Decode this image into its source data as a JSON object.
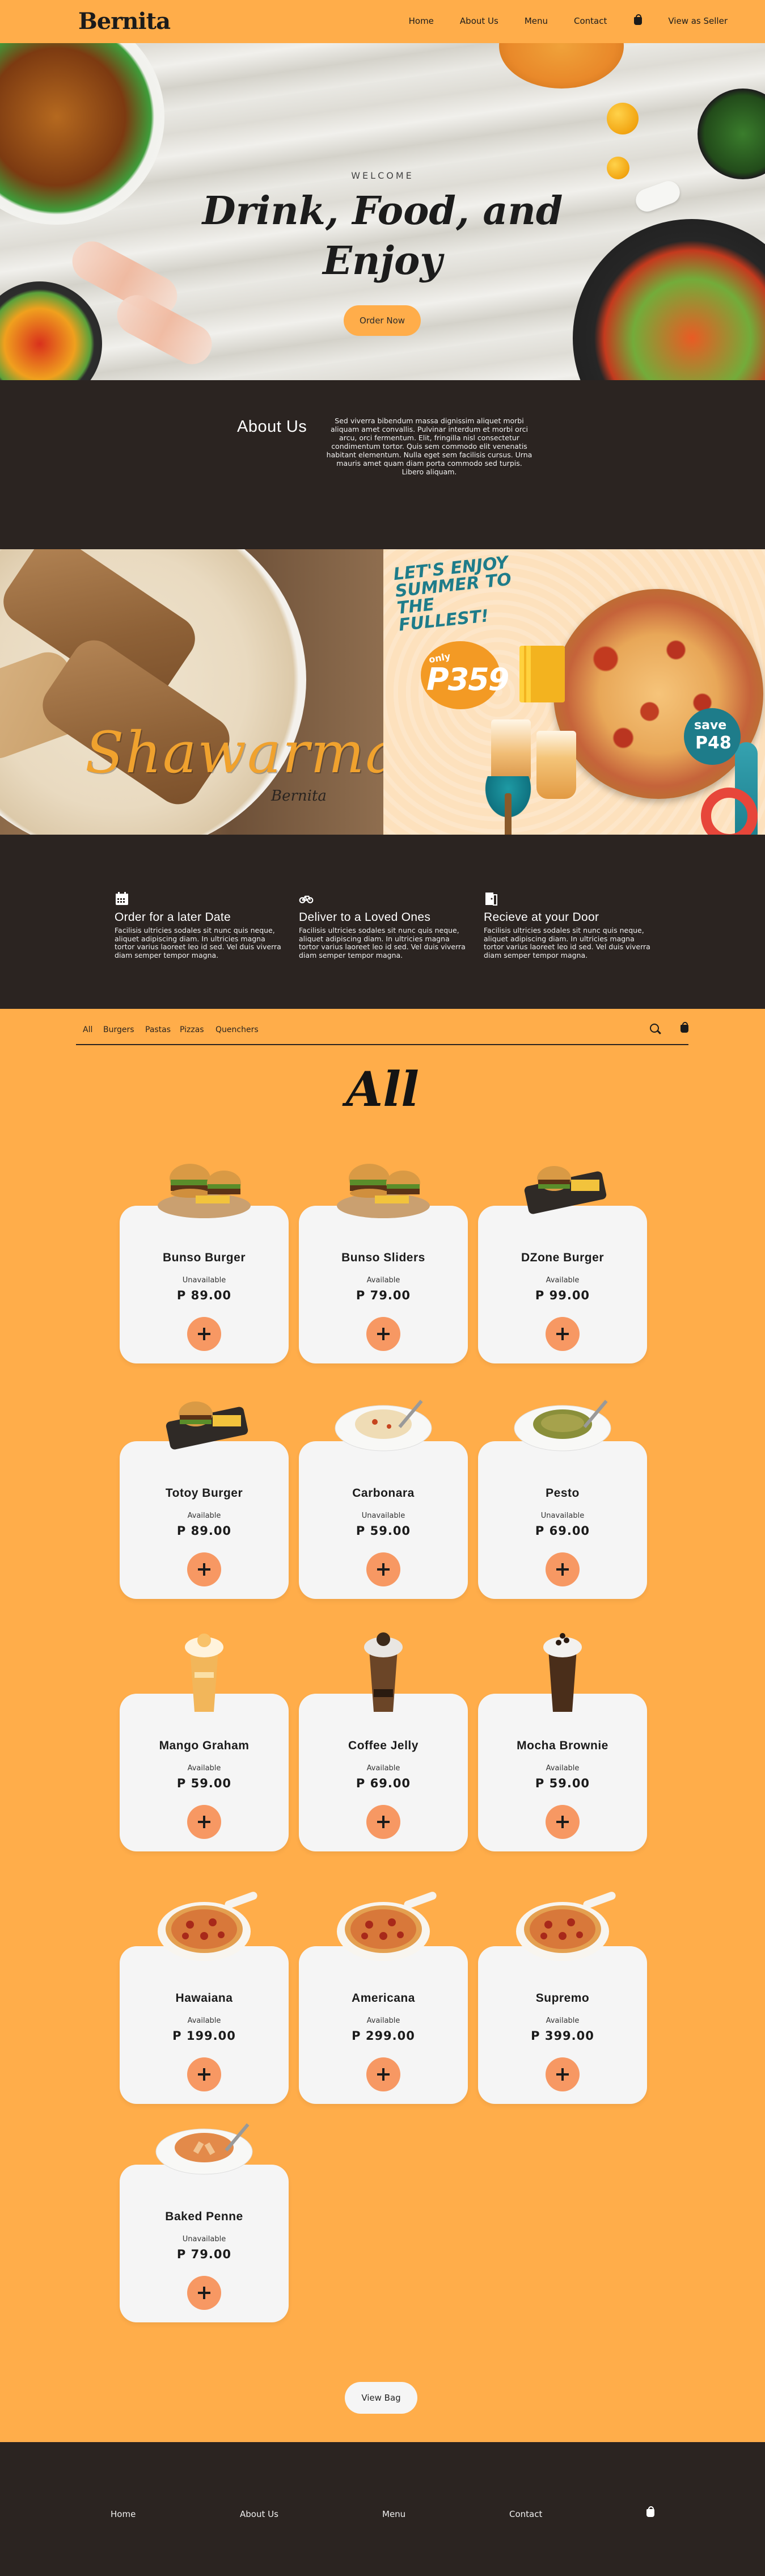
{
  "nav": {
    "brand": "Bernita",
    "brand_tag": "·",
    "links": [
      "Home",
      "About Us",
      "Menu",
      "Contact"
    ],
    "seller": "View as Seller"
  },
  "hero": {
    "welcome": "WELCOME",
    "title_line1": "Drink, Food, and",
    "title_line2": "Enjoy",
    "cta": "Order Now"
  },
  "about": {
    "title": "About Us",
    "text": "Sed viverra bibendum massa dignissim aliquet morbi aliquam amet convallis. Pulvinar interdum et morbi orci arcu, orci fermentum. Elit, fringilla nisl consectetur condimentum tortor. Quis sem commodo elit venenatis habitant elementum. Nulla eget sem facilisis cursus. Urna mauris amet quam diam porta commodo sed turpis. Libero aliquam."
  },
  "promo": {
    "left_title": "Shawarma",
    "left_logo": "Bernita",
    "right_headline": "LET'S ENJOY SUMMER TO THE FULLEST!",
    "only": "only",
    "price": "P359",
    "save": "save",
    "save_amount": "P48"
  },
  "features": [
    {
      "icon": "calendar-icon",
      "title": "Order for a later Date",
      "text": "Facilisis ultricies sodales sit nunc quis neque, aliquet adipiscing diam. In ultricies magna tortor varius laoreet leo id sed. Vel duis viverra diam semper tempor magna."
    },
    {
      "icon": "bicycle-icon",
      "title": "Deliver to a Loved Ones",
      "text": "Facilisis ultricies sodales sit nunc quis neque, aliquet adipiscing diam. In ultricies magna tortor varius laoreet leo id sed. Vel duis viverra diam semper tempor magna."
    },
    {
      "icon": "door-icon",
      "title": "Recieve at your Door",
      "text": "Facilisis ultricies sodales sit nunc quis neque, aliquet adipiscing diam. In ultricies magna tortor varius laoreet leo id sed. Vel duis viverra diam semper tempor magna."
    }
  ],
  "categories": [
    "All",
    "Burgers",
    "Pastas",
    "Pizzas",
    "Quenchers"
  ],
  "section_title": "All",
  "products": [
    {
      "name": "Bunso Burger",
      "status": "Unavailable",
      "price": "P 89.00",
      "kind": "burger"
    },
    {
      "name": "Bunso Sliders",
      "status": "Available",
      "price": "P 79.00",
      "kind": "burger"
    },
    {
      "name": "DZone Burger",
      "status": "Available",
      "price": "P 99.00",
      "kind": "board"
    },
    {
      "name": "Totoy Burger",
      "status": "Available",
      "price": "P 89.00",
      "kind": "board"
    },
    {
      "name": "Carbonara",
      "status": "Unavailable",
      "price": "P 59.00",
      "kind": "pasta-white"
    },
    {
      "name": "Pesto",
      "status": "Unavailable",
      "price": "P 69.00",
      "kind": "pasta-green"
    },
    {
      "name": "Mango Graham",
      "status": "Available",
      "price": "P 59.00",
      "kind": "drink-mango"
    },
    {
      "name": "Coffee Jelly",
      "status": "Available",
      "price": "P 69.00",
      "kind": "drink-coffee"
    },
    {
      "name": "Mocha Brownie",
      "status": "Available",
      "price": "P 59.00",
      "kind": "drink-mocha"
    },
    {
      "name": "Hawaiana",
      "status": "Available",
      "price": "P 199.00",
      "kind": "pizza"
    },
    {
      "name": "Americana",
      "status": "Available",
      "price": "P 299.00",
      "kind": "pizza"
    },
    {
      "name": "Supremo",
      "status": "Available",
      "price": "P 399.00",
      "kind": "pizza"
    },
    {
      "name": "Baked Penne",
      "status": "Unavailable",
      "price": "P 79.00",
      "kind": "penne"
    }
  ],
  "view_bag": "View Bag",
  "footer": {
    "links": [
      "Home",
      "About Us",
      "Menu",
      "Contact"
    ]
  },
  "colors": {
    "accent": "#ffad4a",
    "dark": "#2b2421",
    "card": "#f5f5f5",
    "add_button": "#f79863"
  }
}
